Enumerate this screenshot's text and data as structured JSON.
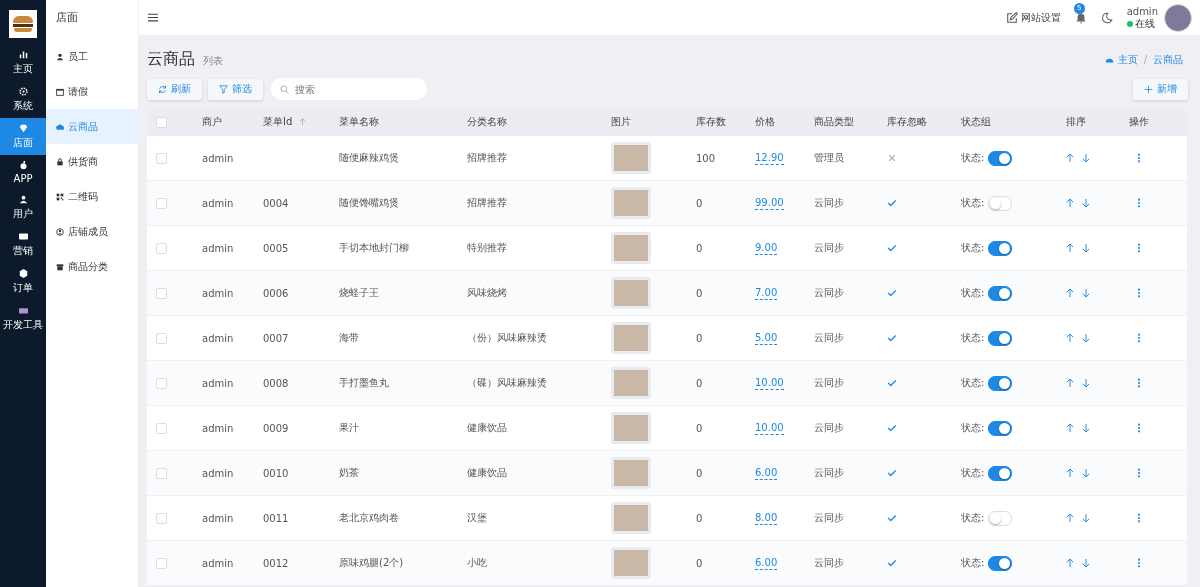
{
  "rail": [
    {
      "label": "主页",
      "selected": false
    },
    {
      "label": "系统",
      "selected": false
    },
    {
      "label": "店面",
      "selected": true
    },
    {
      "label": "APP",
      "selected": false
    },
    {
      "label": "用户",
      "selected": false
    },
    {
      "label": "营销",
      "selected": false
    },
    {
      "label": "订单",
      "selected": false
    },
    {
      "label": "开发工具",
      "selected": false
    }
  ],
  "submenu": {
    "title": "店面",
    "items": [
      {
        "label": "员工",
        "selected": false
      },
      {
        "label": "请假",
        "selected": false
      },
      {
        "label": "云商品",
        "selected": true
      },
      {
        "label": "供货商",
        "selected": false
      },
      {
        "label": "二维码",
        "selected": false
      },
      {
        "label": "店铺成员",
        "selected": false
      },
      {
        "label": "商品分类",
        "selected": false
      }
    ]
  },
  "header": {
    "settings": "网站设置",
    "notifications": "5",
    "user": "admin",
    "status": "在线"
  },
  "page": {
    "title": "云商品",
    "subtitle": "列表",
    "breadcrumb": [
      "主页",
      "云商品"
    ],
    "breadcrumb_separator": "/"
  },
  "toolbar": {
    "refresh": "刷新",
    "filter": "筛选",
    "search": {
      "placeholder": "搜索"
    },
    "add": "新增"
  },
  "table": {
    "select_all_checked": false,
    "columns": [
      "商户",
      "菜单Id",
      "菜单名称",
      "分类名称",
      "图片",
      "库存数",
      "价格",
      "商品类型",
      "库存忽略",
      "状态组",
      "排序",
      "操作"
    ],
    "rows": [
      {
        "checked": false,
        "merchant": "admin",
        "id": "",
        "name": "随便麻辣鸡煲",
        "category": "招牌推荐",
        "stock": "100",
        "price": "12.90",
        "type": "管理员",
        "stock_ignored": false,
        "status_label": "状态:",
        "on": true
      },
      {
        "checked": false,
        "merchant": "admin",
        "id": "0004",
        "name": "随便馋嘴鸡煲",
        "category": "招牌推荐",
        "stock": "0",
        "price": "99.00",
        "type": "云同步",
        "stock_ignored": true,
        "status_label": "状态:",
        "on": false
      },
      {
        "checked": false,
        "merchant": "admin",
        "id": "0005",
        "name": "手切本地封门柳",
        "category": "特别推荐",
        "stock": "0",
        "price": "9.00",
        "type": "云同步",
        "stock_ignored": true,
        "status_label": "状态:",
        "on": true
      },
      {
        "checked": false,
        "merchant": "admin",
        "id": "0006",
        "name": "烧蛏子王",
        "category": "风味烧烤",
        "stock": "0",
        "price": "7.00",
        "type": "云同步",
        "stock_ignored": true,
        "status_label": "状态:",
        "on": true
      },
      {
        "checked": false,
        "merchant": "admin",
        "id": "0007",
        "name": "海带",
        "category": "（份）风味麻辣烫",
        "stock": "0",
        "price": "5.00",
        "type": "云同步",
        "stock_ignored": true,
        "status_label": "状态:",
        "on": true
      },
      {
        "checked": false,
        "merchant": "admin",
        "id": "0008",
        "name": "手打墨鱼丸",
        "category": "（碟）风味麻辣烫",
        "stock": "0",
        "price": "10.00",
        "type": "云同步",
        "stock_ignored": true,
        "status_label": "状态:",
        "on": true
      },
      {
        "checked": false,
        "merchant": "admin",
        "id": "0009",
        "name": "果汁",
        "category": "健康饮品",
        "stock": "0",
        "price": "10.00",
        "type": "云同步",
        "stock_ignored": true,
        "status_label": "状态:",
        "on": true
      },
      {
        "checked": false,
        "merchant": "admin",
        "id": "0010",
        "name": "奶茶",
        "category": "健康饮品",
        "stock": "0",
        "price": "6.00",
        "type": "云同步",
        "stock_ignored": true,
        "status_label": "状态:",
        "on": true
      },
      {
        "checked": false,
        "merchant": "admin",
        "id": "0011",
        "name": "老北京鸡肉卷",
        "category": "汉堡",
        "stock": "0",
        "price": "8.00",
        "type": "云同步",
        "stock_ignored": true,
        "status_label": "状态:",
        "on": false
      },
      {
        "checked": false,
        "merchant": "admin",
        "id": "0012",
        "name": "原味鸡腿(2个)",
        "category": "小吃",
        "stock": "0",
        "price": "6.00",
        "type": "云同步",
        "stock_ignored": true,
        "status_label": "状态:",
        "on": true
      }
    ]
  }
}
